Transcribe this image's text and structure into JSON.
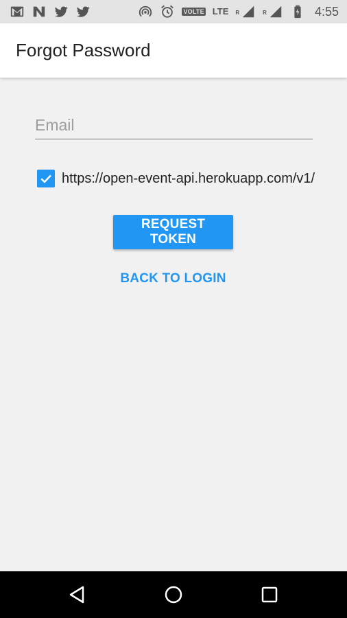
{
  "status_bar": {
    "time": "4:55",
    "volte_label": "VOLTE",
    "network_label": "LTE",
    "roaming_mark_1": "R",
    "roaming_mark_2": "R",
    "left_icons": [
      "gmail-icon",
      "n-app-icon",
      "twitter-icon",
      "twitter-icon"
    ],
    "right_icons": [
      "hotspot-icon",
      "alarm-icon",
      "volte-icon",
      "lte-icon",
      "signal-icon",
      "signal-icon",
      "battery-icon"
    ]
  },
  "app_bar": {
    "title": "Forgot Password"
  },
  "form": {
    "email_placeholder": "Email",
    "email_value": "",
    "api_checkbox_checked": true,
    "api_url": "https://open-event-api.herokuapp.com/v1/",
    "request_button_label": "REQUEST TOKEN",
    "back_link_label": "BACK TO LOGIN"
  },
  "nav_bar": {
    "icons": [
      "back-icon",
      "home-icon",
      "recents-icon"
    ]
  },
  "colors": {
    "accent": "#2196f3",
    "background": "#f1f1f1",
    "status_bar": "#e4e4e4",
    "nav_bar": "#000000"
  }
}
